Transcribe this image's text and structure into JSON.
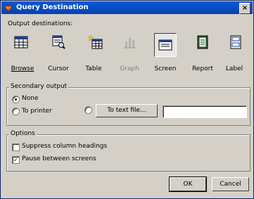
{
  "window": {
    "title": "Query Destination",
    "close_glyph": "×"
  },
  "output": {
    "label": "Output destinations:",
    "buttons": [
      {
        "name": "browse",
        "label": "Browse",
        "icon": "browse-icon",
        "active": false,
        "enabled": true
      },
      {
        "name": "cursor",
        "label": "Cursor",
        "icon": "cursor-icon",
        "active": false,
        "enabled": true
      },
      {
        "name": "table",
        "label": "Table",
        "icon": "table-icon",
        "active": false,
        "enabled": true
      },
      {
        "name": "graph",
        "label": "Graph",
        "icon": "graph-icon",
        "active": false,
        "enabled": false
      },
      {
        "name": "screen",
        "label": "Screen",
        "icon": "screen-icon",
        "active": true,
        "enabled": true
      },
      {
        "name": "report",
        "label": "Report",
        "icon": "report-icon",
        "active": false,
        "enabled": true
      },
      {
        "name": "label",
        "label": "Label",
        "icon": "label-icon",
        "active": false,
        "enabled": true
      }
    ]
  },
  "secondary": {
    "title": "Secondary output",
    "none_label": "None",
    "printer_label": "To printer",
    "textfile_button": "To text file...",
    "textfile_value": "",
    "selected": "None"
  },
  "options": {
    "title": "Options",
    "suppress_label": "Suppress column headings",
    "suppress_checked": false,
    "pause_label": "Pause between screens",
    "pause_checked": true,
    "check_glyph": "✓"
  },
  "actions": {
    "ok": "OK",
    "cancel": "Cancel"
  }
}
